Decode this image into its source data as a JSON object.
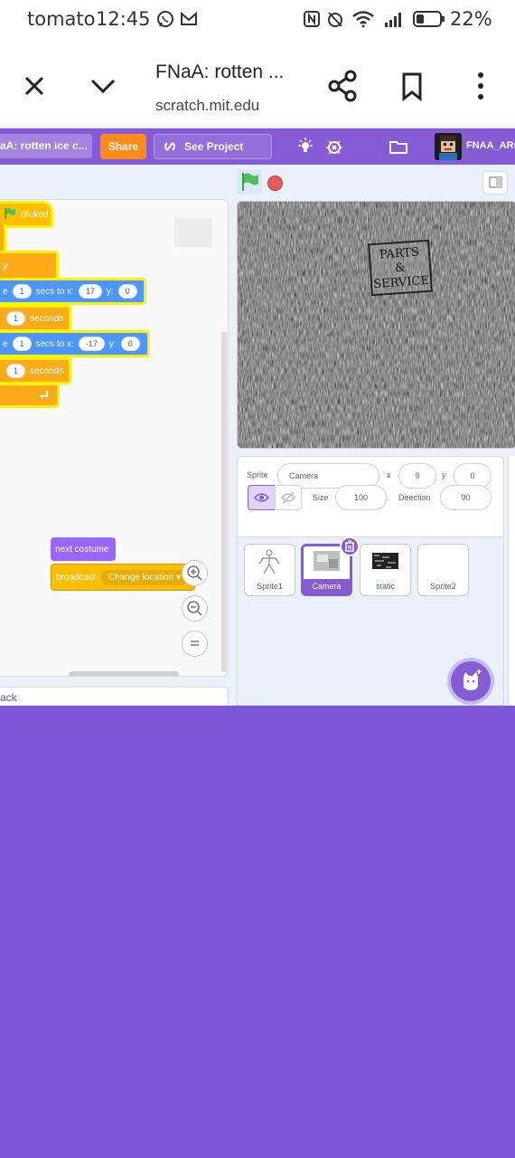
{
  "status_bar": {
    "carrier": "tomato",
    "time": "12:45",
    "battery": "22%"
  },
  "browser": {
    "title": "FNaA: rotten ...",
    "url": "scratch.mit.edu"
  },
  "scratch_header": {
    "project_title": "aA: rotten ice c...",
    "share_label": "Share",
    "see_project_label": "See Project Page",
    "username": "FNAA_ARC"
  },
  "code": {
    "hat_label": "clicked",
    "glide1": {
      "prefix": "e",
      "secs": "1",
      "secs_to_x": "secs to x:",
      "x": "17",
      "y_label": "y:",
      "y": "0"
    },
    "wait1": {
      "value": "1",
      "label": "seconds"
    },
    "glide2": {
      "prefix": "e",
      "secs": "1",
      "secs_to_x": "secs to x:",
      "x": "-17",
      "y_label": "y:",
      "y": "0"
    },
    "wait2": {
      "value": "1",
      "label": "seconds"
    },
    "next_costume": "next costume",
    "broadcast_label": "broadcast",
    "broadcast_message": "Change location",
    "backpack_label": "ack"
  },
  "stage": {
    "sign_text_line1": "PARTS",
    "sign_text_line2": "&",
    "sign_text_line3": "SERVICE"
  },
  "sprite_info": {
    "sprite_label": "Sprite",
    "sprite_name": "Camera",
    "x_label": "x",
    "x_value": "9",
    "y_label": "y",
    "y_value": "0",
    "size_label": "Size",
    "size_value": "100",
    "direction_label": "Direction",
    "direction_value": "90"
  },
  "sprites": [
    {
      "name": "Sprite1"
    },
    {
      "name": "Camera"
    },
    {
      "name": "static"
    },
    {
      "name": "Sprite2"
    }
  ],
  "colors": {
    "scratch_purple": "#855cd6",
    "share_orange": "#ff8c1a",
    "motion_blue": "#4c97ff",
    "control_orange": "#ffab19",
    "looks_purple": "#9966ff",
    "events_yellow": "#ffbf00"
  }
}
